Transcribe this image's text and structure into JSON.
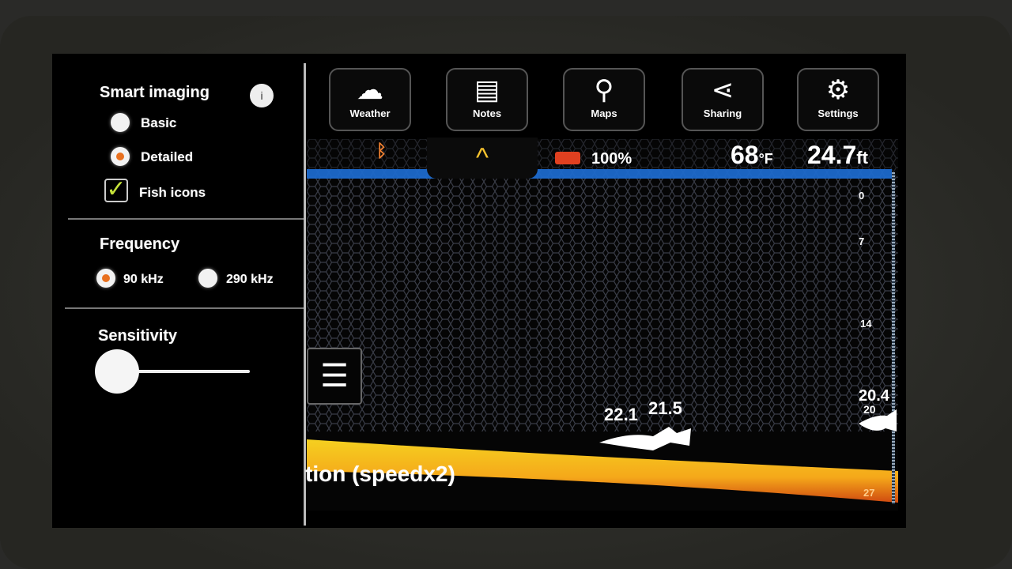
{
  "sidebar": {
    "smart_imaging": {
      "title": "Smart imaging",
      "info_icon": "info-icon",
      "options": [
        {
          "label": "Basic",
          "selected": false
        },
        {
          "label": "Detailed",
          "selected": true
        }
      ],
      "fish_icons": {
        "label": "Fish icons",
        "checked": true
      }
    },
    "frequency": {
      "title": "Frequency",
      "options": [
        {
          "label": "90 kHz",
          "selected": true
        },
        {
          "label": "290 kHz",
          "selected": false
        }
      ]
    },
    "sensitivity": {
      "title": "Sensitivity",
      "value_percent": 0
    }
  },
  "toolbar": [
    {
      "label": "Weather",
      "icon": "weather-icon"
    },
    {
      "label": "Notes",
      "icon": "notes-icon"
    },
    {
      "label": "Maps",
      "icon": "map-pin-icon"
    },
    {
      "label": "Sharing",
      "icon": "share-icon"
    },
    {
      "label": "Settings",
      "icon": "gear-icon"
    }
  ],
  "status": {
    "battery": "100%",
    "temperature": "68",
    "temp_unit": "°F",
    "depth": "24.7",
    "depth_unit": "ft"
  },
  "depth_scale": [
    "0",
    "7",
    "14",
    "27"
  ],
  "fish": [
    {
      "label": "22.1"
    },
    {
      "label": "21.5"
    },
    {
      "label": "20.4"
    },
    {
      "label": "20"
    }
  ],
  "overlay_text": "tion (speedx2)",
  "colors": {
    "accent": "#f7c32e",
    "radio_selected": "#e8701e",
    "check": "#c6e23a",
    "water_surface": "#1e6fd6",
    "bottom": "#f5c518"
  }
}
